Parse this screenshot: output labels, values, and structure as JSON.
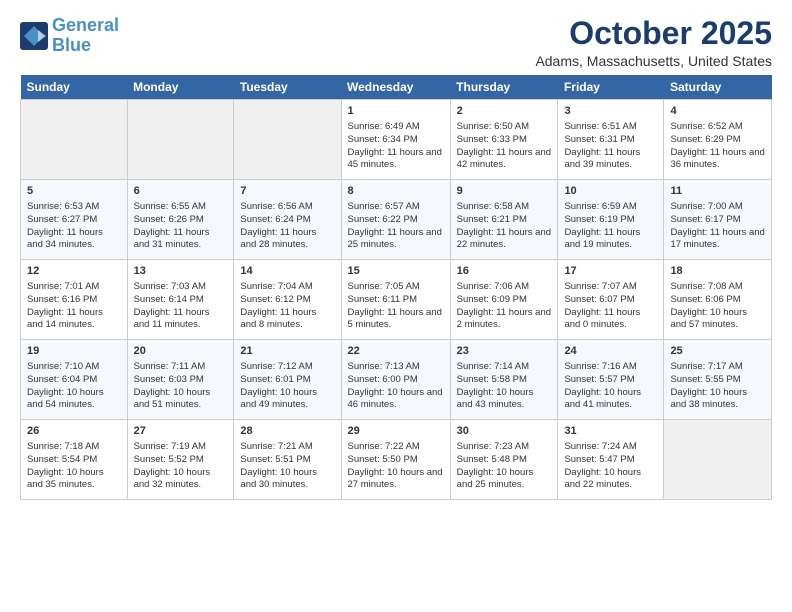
{
  "header": {
    "logo_line1": "General",
    "logo_line2": "Blue",
    "month": "October 2025",
    "location": "Adams, Massachusetts, United States"
  },
  "days_of_week": [
    "Sunday",
    "Monday",
    "Tuesday",
    "Wednesday",
    "Thursday",
    "Friday",
    "Saturday"
  ],
  "weeks": [
    [
      {
        "num": "",
        "info": ""
      },
      {
        "num": "",
        "info": ""
      },
      {
        "num": "",
        "info": ""
      },
      {
        "num": "1",
        "info": "Sunrise: 6:49 AM\nSunset: 6:34 PM\nDaylight: 11 hours and 45 minutes."
      },
      {
        "num": "2",
        "info": "Sunrise: 6:50 AM\nSunset: 6:33 PM\nDaylight: 11 hours and 42 minutes."
      },
      {
        "num": "3",
        "info": "Sunrise: 6:51 AM\nSunset: 6:31 PM\nDaylight: 11 hours and 39 minutes."
      },
      {
        "num": "4",
        "info": "Sunrise: 6:52 AM\nSunset: 6:29 PM\nDaylight: 11 hours and 36 minutes."
      }
    ],
    [
      {
        "num": "5",
        "info": "Sunrise: 6:53 AM\nSunset: 6:27 PM\nDaylight: 11 hours and 34 minutes."
      },
      {
        "num": "6",
        "info": "Sunrise: 6:55 AM\nSunset: 6:26 PM\nDaylight: 11 hours and 31 minutes."
      },
      {
        "num": "7",
        "info": "Sunrise: 6:56 AM\nSunset: 6:24 PM\nDaylight: 11 hours and 28 minutes."
      },
      {
        "num": "8",
        "info": "Sunrise: 6:57 AM\nSunset: 6:22 PM\nDaylight: 11 hours and 25 minutes."
      },
      {
        "num": "9",
        "info": "Sunrise: 6:58 AM\nSunset: 6:21 PM\nDaylight: 11 hours and 22 minutes."
      },
      {
        "num": "10",
        "info": "Sunrise: 6:59 AM\nSunset: 6:19 PM\nDaylight: 11 hours and 19 minutes."
      },
      {
        "num": "11",
        "info": "Sunrise: 7:00 AM\nSunset: 6:17 PM\nDaylight: 11 hours and 17 minutes."
      }
    ],
    [
      {
        "num": "12",
        "info": "Sunrise: 7:01 AM\nSunset: 6:16 PM\nDaylight: 11 hours and 14 minutes."
      },
      {
        "num": "13",
        "info": "Sunrise: 7:03 AM\nSunset: 6:14 PM\nDaylight: 11 hours and 11 minutes."
      },
      {
        "num": "14",
        "info": "Sunrise: 7:04 AM\nSunset: 6:12 PM\nDaylight: 11 hours and 8 minutes."
      },
      {
        "num": "15",
        "info": "Sunrise: 7:05 AM\nSunset: 6:11 PM\nDaylight: 11 hours and 5 minutes."
      },
      {
        "num": "16",
        "info": "Sunrise: 7:06 AM\nSunset: 6:09 PM\nDaylight: 11 hours and 2 minutes."
      },
      {
        "num": "17",
        "info": "Sunrise: 7:07 AM\nSunset: 6:07 PM\nDaylight: 11 hours and 0 minutes."
      },
      {
        "num": "18",
        "info": "Sunrise: 7:08 AM\nSunset: 6:06 PM\nDaylight: 10 hours and 57 minutes."
      }
    ],
    [
      {
        "num": "19",
        "info": "Sunrise: 7:10 AM\nSunset: 6:04 PM\nDaylight: 10 hours and 54 minutes."
      },
      {
        "num": "20",
        "info": "Sunrise: 7:11 AM\nSunset: 6:03 PM\nDaylight: 10 hours and 51 minutes."
      },
      {
        "num": "21",
        "info": "Sunrise: 7:12 AM\nSunset: 6:01 PM\nDaylight: 10 hours and 49 minutes."
      },
      {
        "num": "22",
        "info": "Sunrise: 7:13 AM\nSunset: 6:00 PM\nDaylight: 10 hours and 46 minutes."
      },
      {
        "num": "23",
        "info": "Sunrise: 7:14 AM\nSunset: 5:58 PM\nDaylight: 10 hours and 43 minutes."
      },
      {
        "num": "24",
        "info": "Sunrise: 7:16 AM\nSunset: 5:57 PM\nDaylight: 10 hours and 41 minutes."
      },
      {
        "num": "25",
        "info": "Sunrise: 7:17 AM\nSunset: 5:55 PM\nDaylight: 10 hours and 38 minutes."
      }
    ],
    [
      {
        "num": "26",
        "info": "Sunrise: 7:18 AM\nSunset: 5:54 PM\nDaylight: 10 hours and 35 minutes."
      },
      {
        "num": "27",
        "info": "Sunrise: 7:19 AM\nSunset: 5:52 PM\nDaylight: 10 hours and 32 minutes."
      },
      {
        "num": "28",
        "info": "Sunrise: 7:21 AM\nSunset: 5:51 PM\nDaylight: 10 hours and 30 minutes."
      },
      {
        "num": "29",
        "info": "Sunrise: 7:22 AM\nSunset: 5:50 PM\nDaylight: 10 hours and 27 minutes."
      },
      {
        "num": "30",
        "info": "Sunrise: 7:23 AM\nSunset: 5:48 PM\nDaylight: 10 hours and 25 minutes."
      },
      {
        "num": "31",
        "info": "Sunrise: 7:24 AM\nSunset: 5:47 PM\nDaylight: 10 hours and 22 minutes."
      },
      {
        "num": "",
        "info": ""
      }
    ]
  ]
}
